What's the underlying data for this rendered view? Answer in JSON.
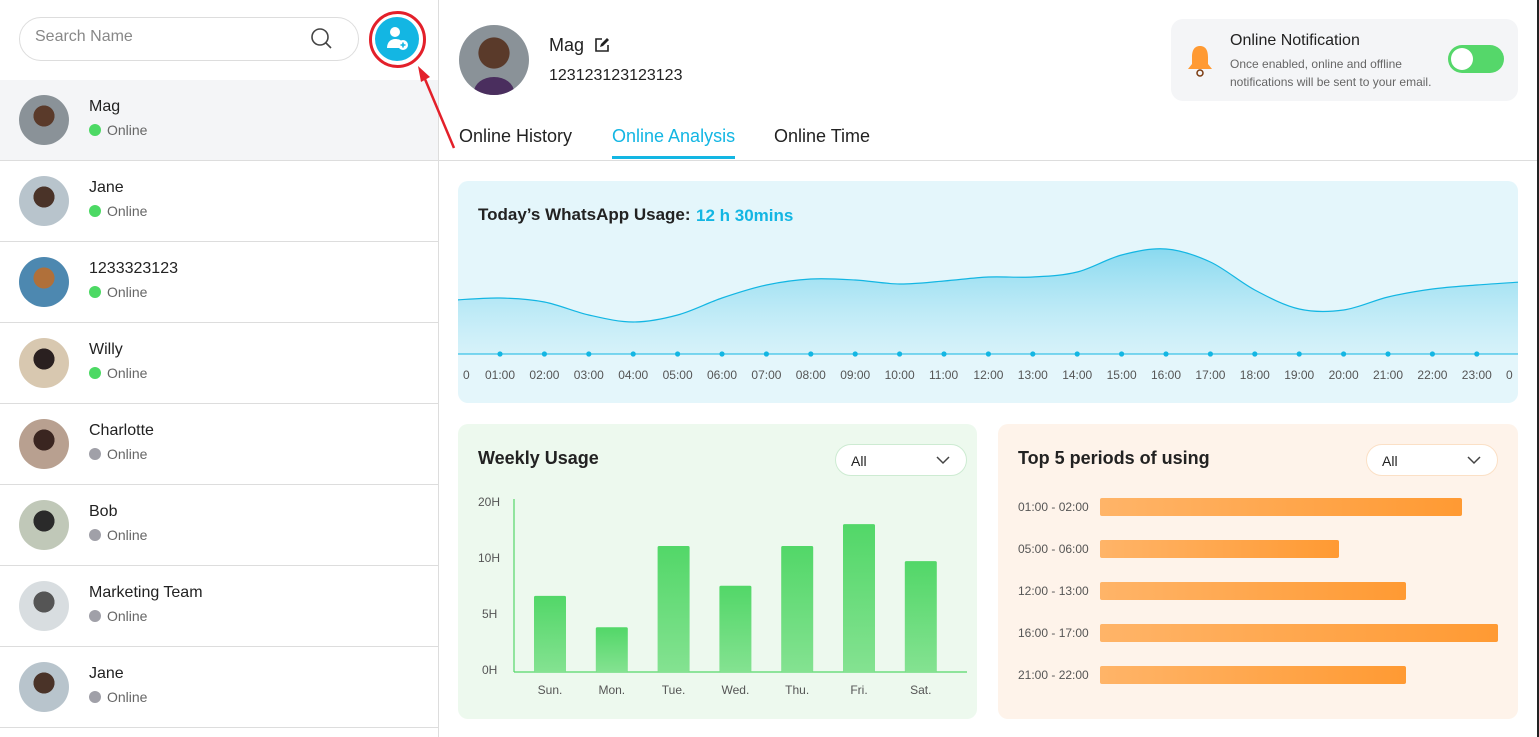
{
  "search": {
    "placeholder": "Search Name",
    "icon": "search-icon"
  },
  "add_contact": {
    "icon": "add-user-icon",
    "highlight_color": "#e3202a"
  },
  "contacts": [
    {
      "name": "Mag",
      "status": "Online",
      "active": true,
      "selected": true
    },
    {
      "name": "Jane",
      "status": "Online",
      "active": true
    },
    {
      "name": "1233323123",
      "status": "Online",
      "active": true
    },
    {
      "name": "Willy",
      "status": "Online",
      "active": true
    },
    {
      "name": "Charlotte",
      "status": "Online",
      "active": false
    },
    {
      "name": "Bob",
      "status": "Online",
      "active": false
    },
    {
      "name": "Marketing Team",
      "status": "Online",
      "active": false
    },
    {
      "name": "Jane",
      "status": "Online",
      "active": false
    }
  ],
  "profile": {
    "name": "Mag",
    "phone": "123123123123123",
    "edit_icon": "edit-icon"
  },
  "notification": {
    "title": "Online Notification",
    "description_line1": "Once enabled, online and offline",
    "description_line2": "notifications will be sent to your email.",
    "enabled": true,
    "icon": "bell-icon"
  },
  "tabs": [
    {
      "label": "Online History"
    },
    {
      "label": "Online Analysis",
      "active": true
    },
    {
      "label": "Online Time"
    }
  ],
  "colors": {
    "accent": "#13b6e3",
    "online": "#4cd964",
    "offline": "#a0a0a8",
    "green_bar": "#55d76a",
    "orange_bar": "#ff9a33"
  },
  "chart_data": [
    {
      "type": "area",
      "title": "Today’s WhatsApp Usage:",
      "total": "12 h 30mins",
      "x_ticks": [
        "0",
        "01:00",
        "02:00",
        "03:00",
        "04:00",
        "05:00",
        "06:00",
        "07:00",
        "08:00",
        "09:00",
        "10:00",
        "11:00",
        "12:00",
        "13:00",
        "14:00",
        "15:00",
        "16:00",
        "17:00",
        "18:00",
        "19:00",
        "20:00",
        "21:00",
        "22:00",
        "23:00",
        "0"
      ],
      "x": [
        0,
        1,
        2,
        3,
        4,
        5,
        6,
        7,
        8,
        9,
        10,
        11,
        12,
        13,
        14,
        15,
        16,
        17,
        18,
        19,
        20,
        21,
        22,
        23,
        24
      ],
      "values": [
        54,
        56,
        52,
        39,
        32,
        39,
        56,
        69,
        75,
        74,
        70,
        73,
        77,
        77,
        82,
        99,
        105,
        92,
        64,
        45,
        44,
        57,
        65,
        69,
        72
      ]
    },
    {
      "type": "bar",
      "title": "Weekly Usage",
      "filter": "All",
      "categories": [
        "Sun.",
        "Mon.",
        "Tue.",
        "Wed.",
        "Thu.",
        "Fri.",
        "Sat."
      ],
      "values": [
        6.8,
        4,
        12.5,
        7.7,
        12.5,
        16.4,
        9.9
      ],
      "y_ticks": [
        "0H",
        "5H",
        "10H",
        "20H"
      ],
      "y_tick_values": [
        0,
        5,
        10,
        20
      ]
    },
    {
      "type": "bar",
      "orientation": "horizontal",
      "title": "Top 5 periods of using",
      "filter": "All",
      "categories": [
        "01:00 - 02:00",
        "05:00 - 06:00",
        "12:00 - 13:00",
        "16:00 - 17:00",
        "21:00 - 22:00"
      ],
      "values": [
        0.91,
        0.6,
        0.77,
        1.0,
        0.77
      ]
    }
  ]
}
